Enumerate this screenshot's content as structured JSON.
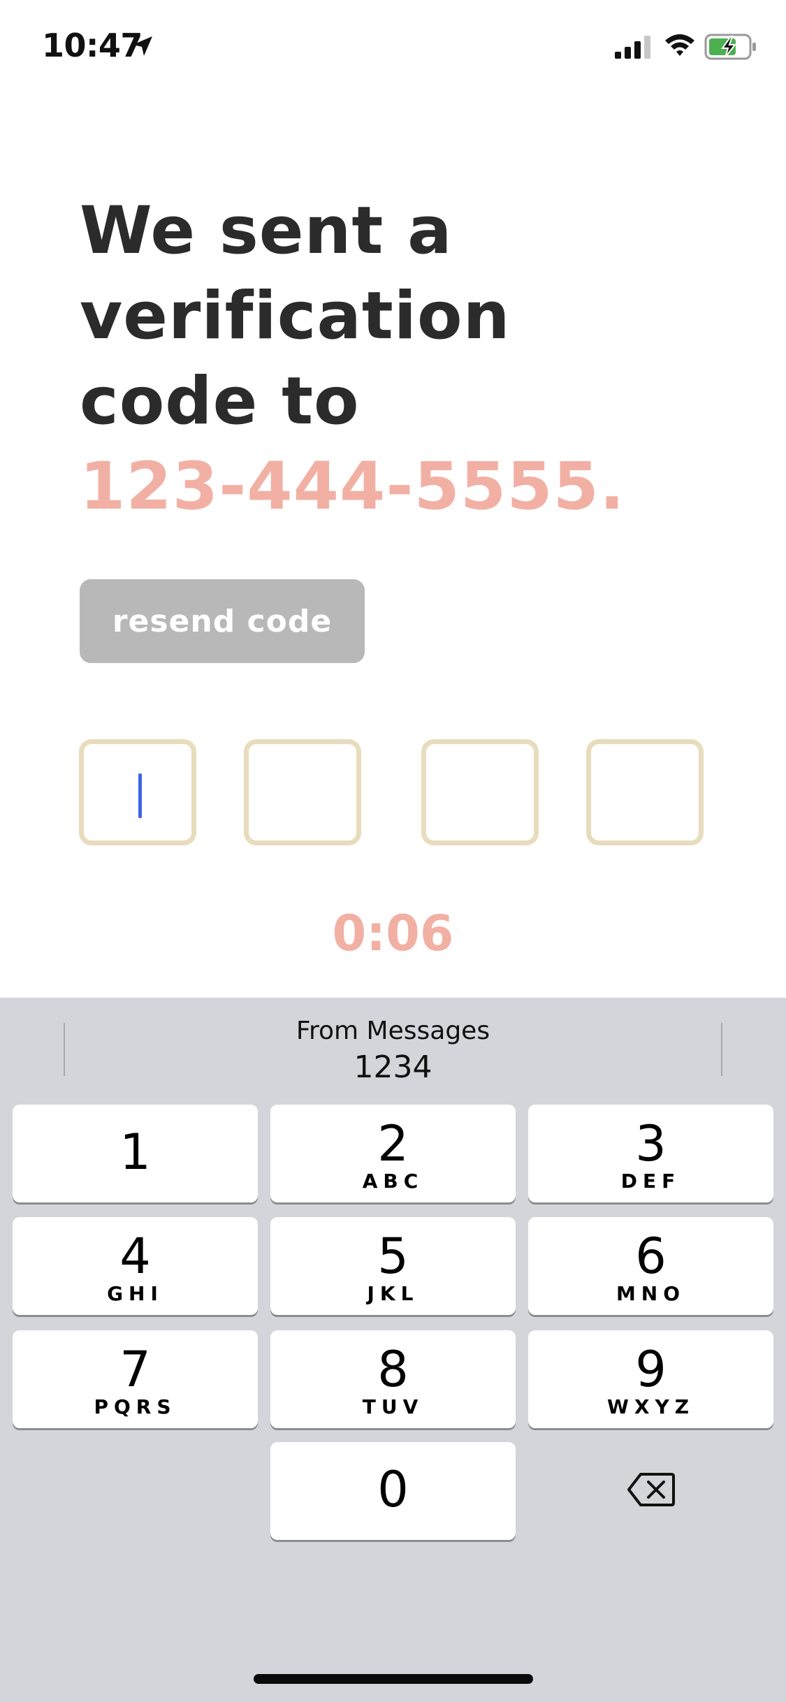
{
  "status_bar": {
    "time": "10:47",
    "icons": [
      "location-arrow-icon",
      "cellular-signal-icon",
      "wifi-icon",
      "battery-charging-icon"
    ],
    "battery_color": "#4caf50"
  },
  "main": {
    "headline_lines": [
      "We sent a",
      "verification",
      "code to"
    ],
    "phone_number": "123-444-5555.",
    "resend_label": "resend code",
    "code_digits": [
      "",
      "",
      "",
      ""
    ],
    "timer": "0:06"
  },
  "keyboard": {
    "suggestion": {
      "source": "From Messages",
      "code": "1234"
    },
    "keys": [
      {
        "num": "1",
        "letters": ""
      },
      {
        "num": "2",
        "letters": "ABC"
      },
      {
        "num": "3",
        "letters": "DEF"
      },
      {
        "num": "4",
        "letters": "GHI"
      },
      {
        "num": "5",
        "letters": "JKL"
      },
      {
        "num": "6",
        "letters": "MNO"
      },
      {
        "num": "7",
        "letters": "PQRS"
      },
      {
        "num": "8",
        "letters": "TUV"
      },
      {
        "num": "9",
        "letters": "WXYZ"
      },
      {
        "num": "0",
        "letters": ""
      }
    ],
    "delete_icon": "backspace-icon"
  },
  "colors": {
    "accent": "#f2b0a4",
    "heading": "#2b2b2b",
    "button_disabled": "#b8b8b8",
    "box_border": "#e8dcbd",
    "cursor": "#3f64e6",
    "keyboard_bg": "#d3d5da"
  }
}
